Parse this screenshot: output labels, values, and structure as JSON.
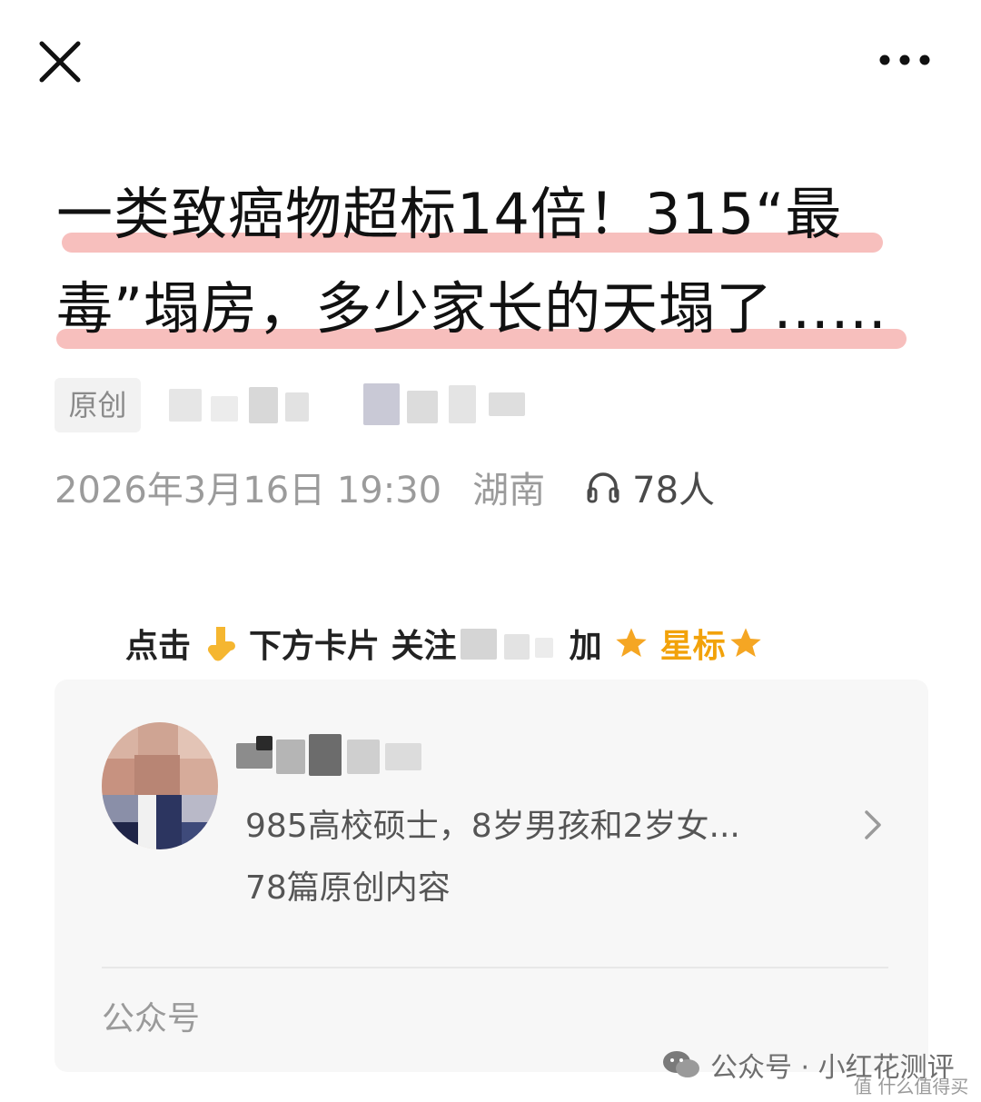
{
  "header": {
    "close_icon": "close-icon",
    "more_icon": "more-dots-icon"
  },
  "article": {
    "title_line1": "一类致癌物超标14倍！315“最",
    "title_line2": "毒”塌房，多少家长的天塌了……",
    "original_tag": "原创",
    "date": "2026年3月16日 19:30",
    "location": "湖南",
    "listeners": "78人",
    "listen_icon": "headphones-icon"
  },
  "follow_prompt": {
    "part1": "点击",
    "part2": "下方卡片 关注",
    "part3": "加",
    "part4": "星标",
    "pointer_icon": "pointing-down-hand-icon",
    "star_icon": "star-icon",
    "accent_color": "#f2a20a"
  },
  "profile_card": {
    "description": "985高校硕士，8岁男孩和2岁女...",
    "article_count": "78篇原创内容",
    "account_type": "公众号",
    "chevron_icon": "chevron-right-icon"
  },
  "watermark": {
    "text": "公众号 · 小红花测评",
    "site": "值 什么值得买",
    "icon": "wechat-icon"
  }
}
